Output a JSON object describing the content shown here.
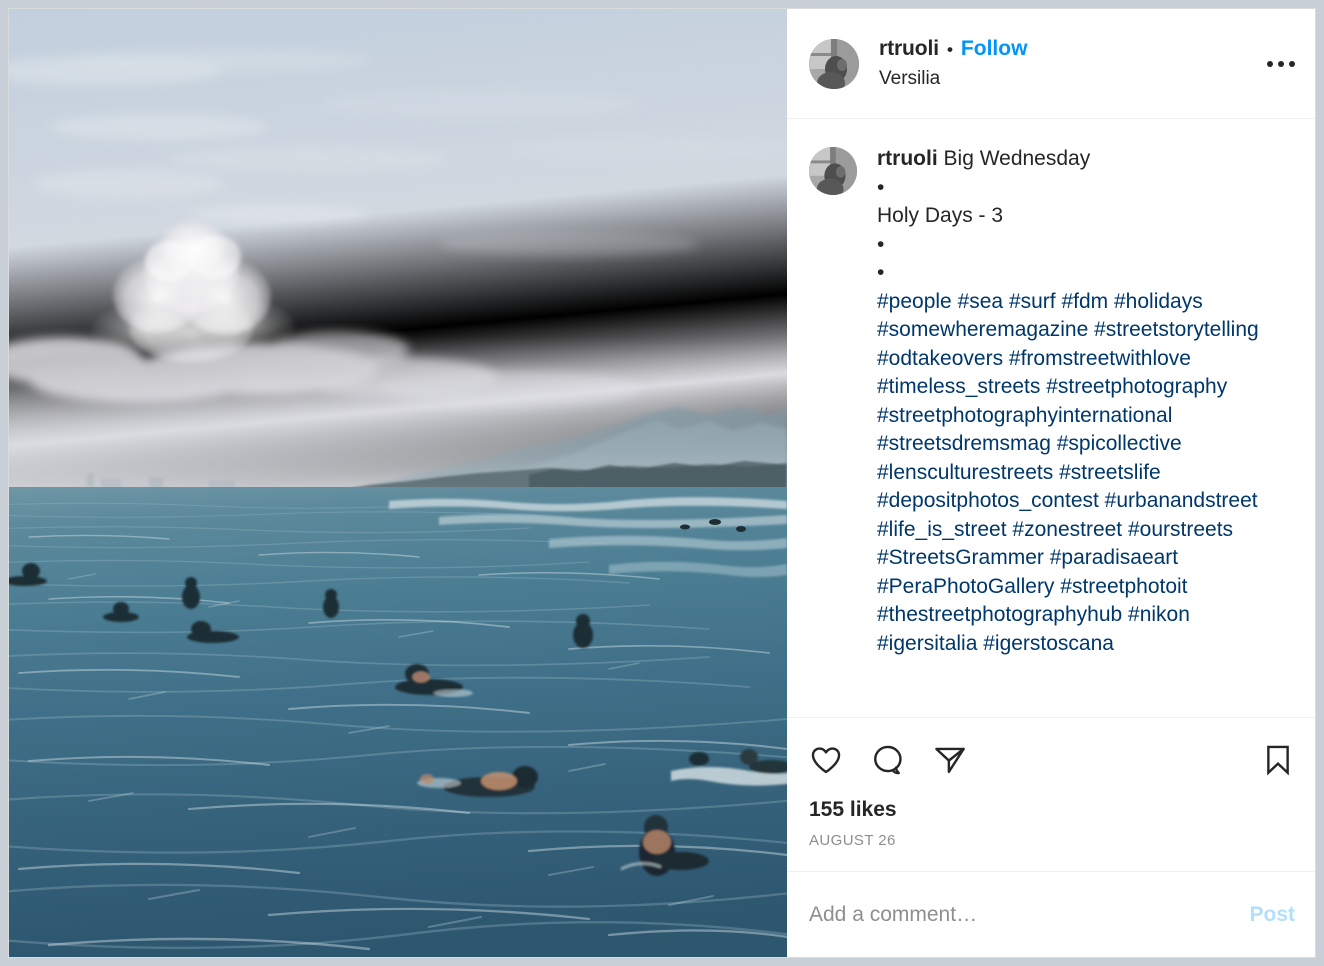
{
  "post": {
    "header": {
      "username": "rtruoli",
      "separator": "•",
      "follow_label": "Follow",
      "location": "Versilia",
      "more_options_label": "More options"
    },
    "caption": {
      "author": "rtruoli",
      "lines": [
        "Big Wednesday",
        "•",
        "Holy Days - 3",
        "•",
        "•"
      ],
      "hashtags": "#people #sea #surf #fdm #holidays #somewheremagazine #streetstorytelling #odtakeovers #fromstreetwithlove #timeless_streets #streetphotography #streetphotographyinternational #streetsdremsmag #spicollective #lensculturestreets #streetslife #depositphotos_contest #urbanandstreet #life_is_street #zonestreet #ourstreets #StreetsGrammer #paradisaeart #PeraPhotoGallery #streetphotoit #thestreetphotographyhub #nikon #igersitalia #igerstoscana"
    },
    "actions": {
      "like_label": "Like",
      "comment_label": "Comment",
      "share_label": "Share",
      "save_label": "Save"
    },
    "stats": {
      "likes": "155 likes",
      "date": "AUGUST 26"
    },
    "comment_box": {
      "placeholder": "Add a comment…",
      "post_label": "Post"
    },
    "photo": {
      "alt": "Surfers waiting in the sea at Versilia beach under a hazy sky with mountains on the horizon"
    },
    "colors": {
      "link_blue": "#0095f6",
      "hashtag_blue": "#00376b",
      "text_primary": "#262626",
      "text_secondary": "#8e8e8e",
      "post_disabled": "#b2dffc",
      "divider": "#efefef"
    }
  }
}
